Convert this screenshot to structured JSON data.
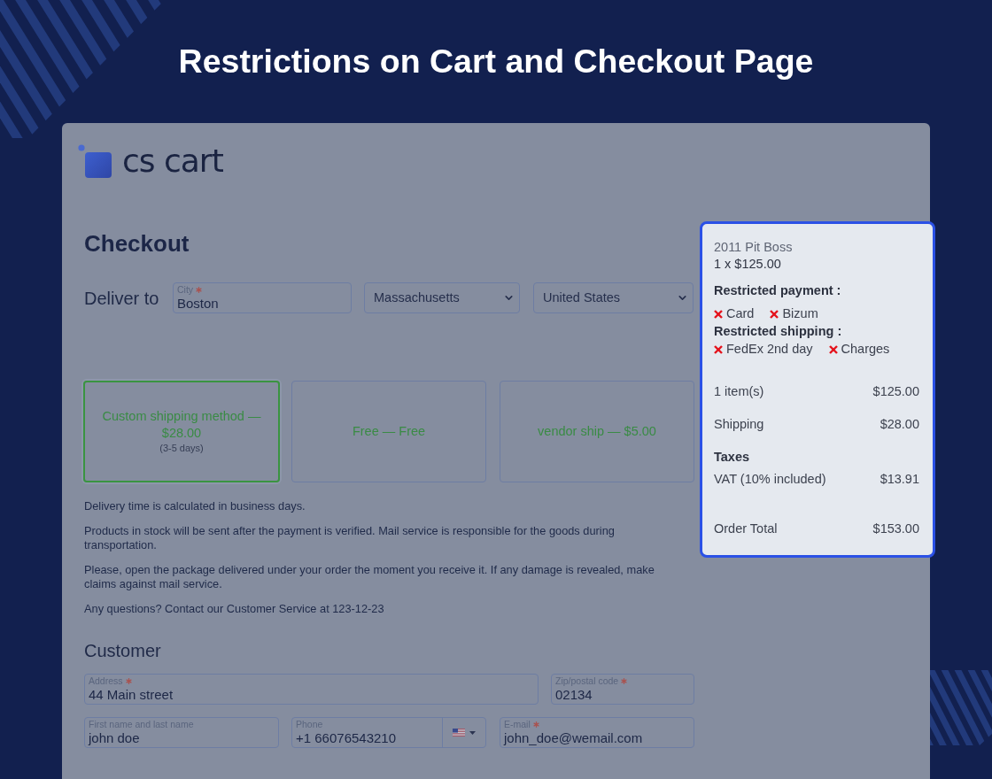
{
  "banner": {
    "title": "Restrictions on Cart and Checkout Page"
  },
  "logo": {
    "text": "cs cart"
  },
  "checkout": {
    "heading": "Checkout",
    "deliver_label": "Deliver to",
    "city": {
      "label": "City",
      "required": true,
      "value": "Boston"
    },
    "state": "Massachusetts",
    "country": "United States"
  },
  "shipping_methods": [
    {
      "label": "Custom shipping method — $28.00",
      "note": "(3-5 days)",
      "selected": true
    },
    {
      "label": "Free — Free",
      "selected": false
    },
    {
      "label": "vendor ship — $5.00",
      "selected": false
    }
  ],
  "notes": [
    "Delivery time is calculated in business days.",
    "Products in stock will be sent after the payment is verified. Mail service is responsible for the goods during transportation.",
    "Please, open the package delivered under your order the moment you receive it. If any damage is revealed, make claims against mail service.",
    "Any questions? Contact our Customer Service at 123-12-23"
  ],
  "customer": {
    "heading": "Customer",
    "address": {
      "label": "Address",
      "required": true,
      "value": "44 Main street"
    },
    "zip": {
      "label": "Zip/postal code",
      "required": true,
      "value": "02134"
    },
    "name": {
      "label": "First name and last name",
      "required": false,
      "value": "john doe"
    },
    "phone": {
      "label": "Phone",
      "required": false,
      "value": "+1 66076543210"
    },
    "email": {
      "label": "E-mail",
      "required": true,
      "value": "john_doe@wemail.com"
    }
  },
  "summary": {
    "product": "2011 Pit Boss",
    "quantity": "1 x $125.00",
    "restrictions": [
      {
        "title": "Restricted payment :",
        "items": [
          "Card",
          "Bizum"
        ]
      },
      {
        "title": "Restricted shipping :",
        "items": [
          "FedEx 2nd day",
          "Charges"
        ]
      }
    ],
    "subtotals": [
      {
        "label": "1 item(s)",
        "value": "$125.00"
      },
      {
        "label": "Shipping",
        "value": "$28.00"
      }
    ],
    "taxes": {
      "title": "Taxes",
      "items": [
        {
          "label": "VAT (10% included)",
          "value": "$13.91"
        }
      ]
    },
    "total": {
      "label": "Order Total",
      "value": "$153.00"
    }
  }
}
